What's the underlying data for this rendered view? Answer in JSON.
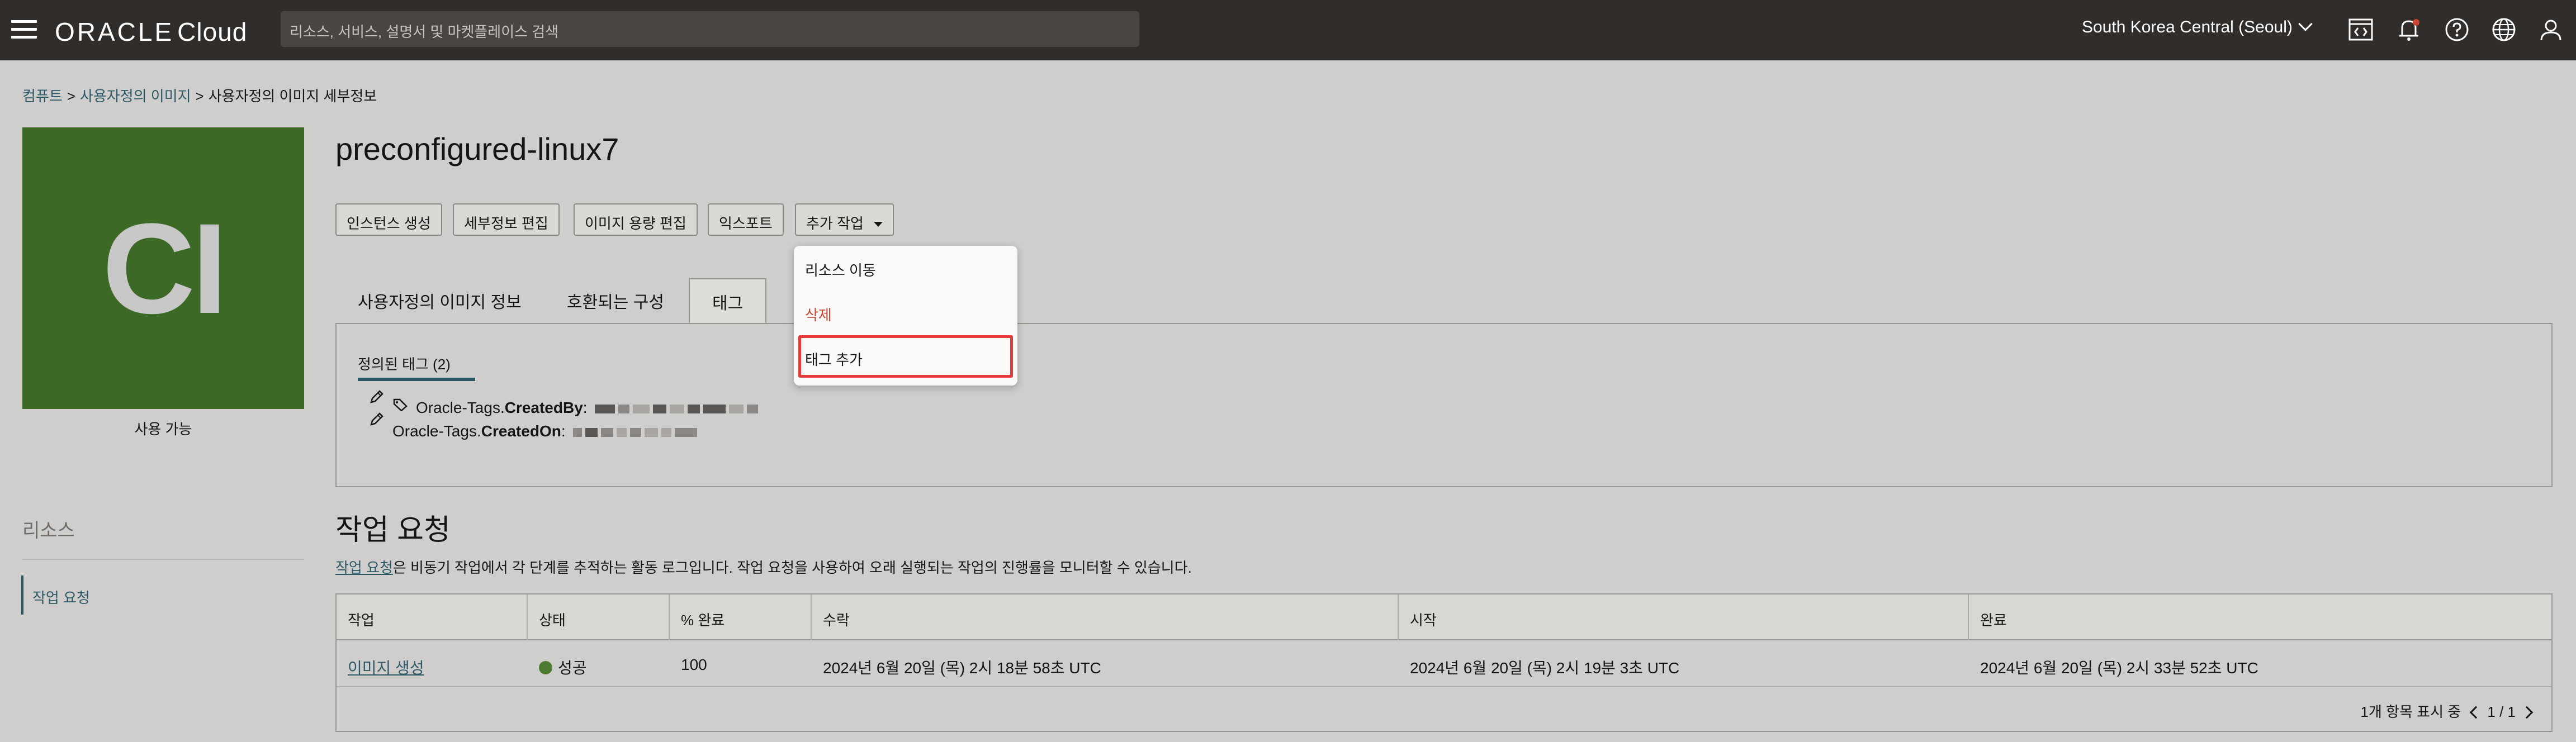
{
  "header": {
    "logo_brand": "ORACLE",
    "logo_product": "Cloud",
    "search_placeholder": "리소스, 서비스, 설명서 및 마켓플레이스 검색",
    "region": "South Korea Central (Seoul)"
  },
  "breadcrumb": {
    "items": [
      "컴퓨트",
      "사용자정의 이미지",
      "사용자정의 이미지 세부정보"
    ],
    "separator": ">"
  },
  "image": {
    "avatar_initials": "CI",
    "avatar_color": "#3c6925",
    "status": "사용 가능",
    "title": "preconfigured-linux7"
  },
  "actions": {
    "create_instance": "인스턴스 생성",
    "edit_details": "세부정보 편집",
    "edit_image_capacity": "이미지 용량 편집",
    "export": "익스포트",
    "more_actions": "추가 작업"
  },
  "more_actions_menu": {
    "items": [
      {
        "label": "리소스 이동"
      },
      {
        "label": "삭제"
      },
      {
        "label": "태그 추가"
      }
    ]
  },
  "tabs": {
    "items": [
      {
        "label": "사용자정의 이미지 정보"
      },
      {
        "label": "호환되는 구성"
      },
      {
        "label": "태그"
      }
    ],
    "active": "태그"
  },
  "tags": {
    "subtab": "정의된 태그 (2)",
    "rows": [
      {
        "namespace": "Oracle-Tags.",
        "key": "CreatedBy",
        "suffix": ":"
      },
      {
        "namespace": "Oracle-Tags.",
        "key": "CreatedOn",
        "suffix": ":"
      }
    ]
  },
  "resources": {
    "title": "리소스",
    "items": [
      "작업 요청"
    ]
  },
  "work_requests": {
    "title": "작업 요청",
    "desc_link": "작업 요청",
    "desc_rest": "은 비동기 작업에서 각 단계를 추적하는 활동 로그입니다. 작업 요청을 사용하여 오래 실행되는 작업의 진행률을 모니터할 수 있습니다.",
    "columns": [
      "작업",
      "상태",
      "% 완료",
      "수락",
      "시작",
      "완료"
    ],
    "rows": [
      {
        "operation": "이미지 생성",
        "status": "성공",
        "percent": "100",
        "accepted": "2024년 6월 20일 (목) 2시 18분 58초 UTC",
        "started": "2024년 6월 20일 (목) 2시 19분 3초 UTC",
        "finished": "2024년 6월 20일 (목) 2시 33분 52초 UTC"
      }
    ],
    "footer_count": "1개 항목 표시 중",
    "pagination": "1 / 1"
  },
  "colors": {
    "topbar": "#312d2a",
    "link": "#2d5967",
    "danger": "#c74634",
    "success": "#4c7a2e",
    "highlight": "#e03a3a"
  }
}
